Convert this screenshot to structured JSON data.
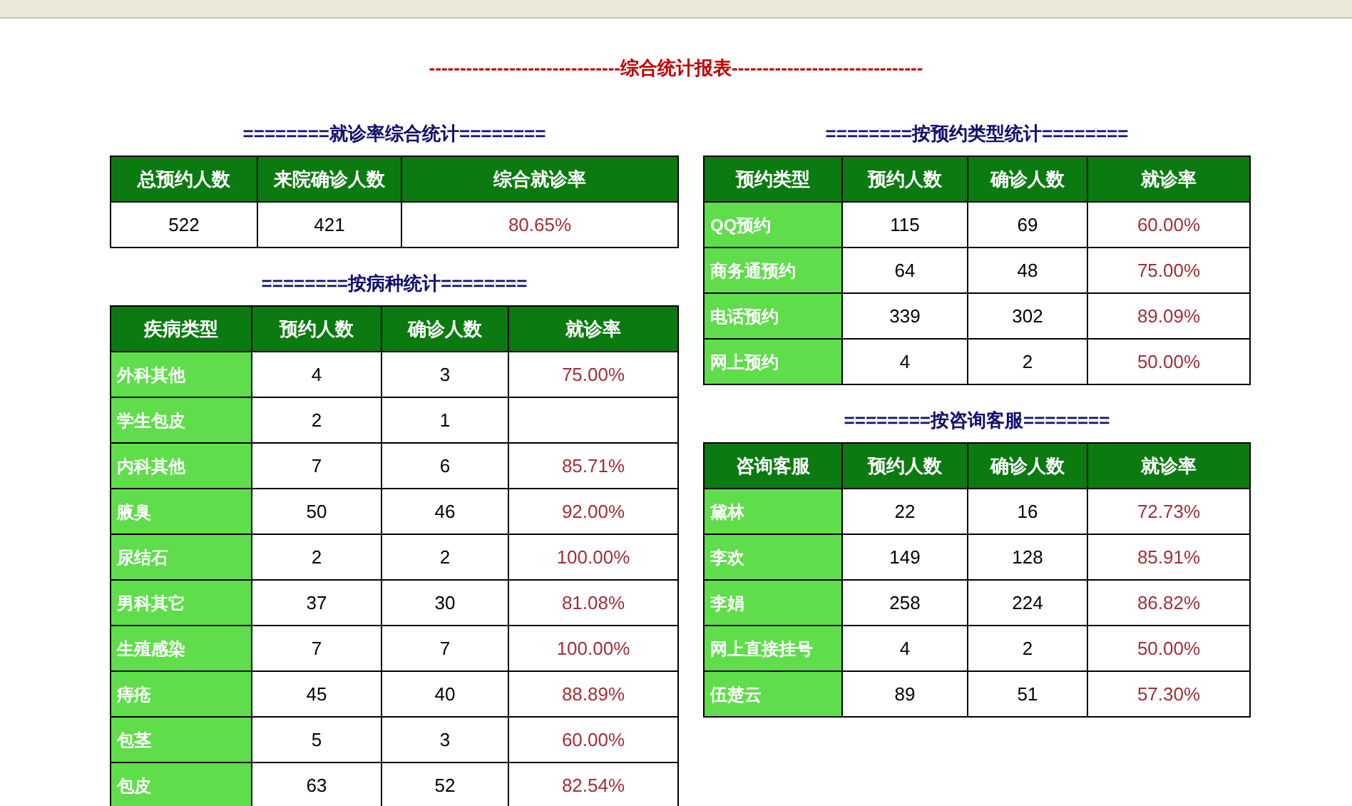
{
  "report_title": "-------------------------------综合统计报表-------------------------------",
  "left": [
    {
      "kind": "summary",
      "title": "========就诊率综合统计========",
      "columns": [
        "总预约人数",
        "来院确诊人数",
        "综合就诊率"
      ],
      "rows": [
        {
          "cells": [
            "522",
            "421",
            "80.65%"
          ]
        }
      ]
    },
    {
      "kind": "breakdown",
      "title": "========按病种统计========",
      "columns": [
        "疾病类型",
        "预约人数",
        "确诊人数",
        "就诊率"
      ],
      "rows": [
        {
          "label": "外科其他",
          "booked": "4",
          "confirmed": "3",
          "rate": "75.00%"
        },
        {
          "label": "学生包皮",
          "booked": "2",
          "confirmed": "1"
        },
        {
          "label": "内科其他",
          "booked": "7",
          "confirmed": "6",
          "rate": "85.71%"
        },
        {
          "label": "腋臭",
          "booked": "50",
          "confirmed": "46",
          "rate": "92.00%"
        },
        {
          "label": "尿结石",
          "booked": "2",
          "confirmed": "2",
          "rate": "100.00%"
        },
        {
          "label": "男科其它",
          "booked": "37",
          "confirmed": "30",
          "rate": "81.08%"
        },
        {
          "label": "生殖感染",
          "booked": "7",
          "confirmed": "7",
          "rate": "100.00%"
        },
        {
          "label": "痔疮",
          "booked": "45",
          "confirmed": "40",
          "rate": "88.89%"
        },
        {
          "label": "包茎",
          "booked": "5",
          "confirmed": "3",
          "rate": "60.00%"
        },
        {
          "label": "包皮",
          "booked": "63",
          "confirmed": "52",
          "rate": "82.54%"
        }
      ]
    }
  ],
  "right": [
    {
      "kind": "breakdown",
      "title": "========按预约类型统计========",
      "columns": [
        "预约类型",
        "预约人数",
        "确诊人数",
        "就诊率"
      ],
      "rows": [
        {
          "label": "QQ预约",
          "booked": "115",
          "confirmed": "69",
          "rate": "60.00%"
        },
        {
          "label": "商务通预约",
          "booked": "64",
          "confirmed": "48",
          "rate": "75.00%"
        },
        {
          "label": "电话预约",
          "booked": "339",
          "confirmed": "302",
          "rate": "89.09%"
        },
        {
          "label": "网上预约",
          "booked": "4",
          "confirmed": "2",
          "rate": "50.00%"
        }
      ]
    },
    {
      "kind": "breakdown",
      "title": "========按咨询客服========",
      "columns": [
        "咨询客服",
        "预约人数",
        "确诊人数",
        "就诊率"
      ],
      "rows": [
        {
          "label": "黛林",
          "booked": "22",
          "confirmed": "16",
          "rate": "72.73%"
        },
        {
          "label": "李欢",
          "booked": "149",
          "confirmed": "128",
          "rate": "85.91%"
        },
        {
          "label": "李娟",
          "booked": "258",
          "confirmed": "224",
          "rate": "86.82%"
        },
        {
          "label": "网上直接挂号",
          "booked": "4",
          "confirmed": "2",
          "rate": "50.00%"
        },
        {
          "label": "伍楚云",
          "booked": "89",
          "confirmed": "51",
          "rate": "57.30%"
        }
      ]
    }
  ]
}
